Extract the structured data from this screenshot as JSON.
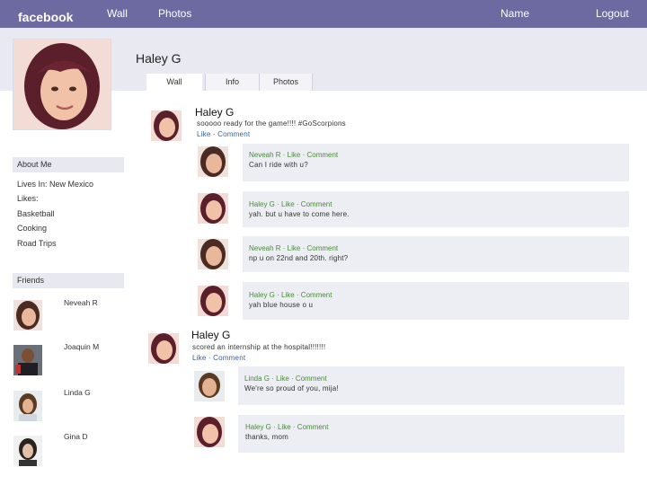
{
  "topbar": {
    "logo": "facebook",
    "nav_wall": "Wall",
    "nav_photos": "Photos",
    "nav_name": "Name",
    "nav_logout": "Logout"
  },
  "profile": {
    "name": "Haley G",
    "tabs": [
      "Wall",
      "Info",
      "Photos"
    ]
  },
  "about": {
    "heading": "About Me",
    "lives_in": "Lives In: New Mexico",
    "likes_label": "Likes:",
    "likes": [
      "Basketball",
      "Cooking",
      "Road Trips"
    ]
  },
  "friends": {
    "heading": "Friends",
    "list": [
      {
        "name": "Neveah R"
      },
      {
        "name": "Joaquin M"
      },
      {
        "name": "Linda G"
      },
      {
        "name": "Gina D"
      }
    ]
  },
  "posts": [
    {
      "author": "Haley G",
      "text": "sooooo ready for the game!!!! #GoScorpions",
      "actions": "Like · Comment",
      "comments": [
        {
          "meta": "Neveah R · Like · Comment",
          "text": "Can I ride with u?"
        },
        {
          "meta": "Haley G ·  Like · Comment",
          "text": "yah. but u have to come here."
        },
        {
          "meta": "Neveah R · Like · Comment",
          "text": "np u on 22nd and 20th. right?"
        },
        {
          "meta": "Haley G ·  Like · Comment",
          "text": "yah blue house o u"
        }
      ]
    },
    {
      "author": "Haley G",
      "text": "scored an internship at the hospital!!!!!!!",
      "actions": "Like · Comment",
      "comments": [
        {
          "meta": "Linda G · Like · Comment",
          "text": "We're so proud of you, mija!"
        },
        {
          "meta": "Haley G ·  Like · Comment",
          "text": "thanks, mom"
        }
      ]
    }
  ],
  "colors": {
    "topbar": "#6c6aa0",
    "header_band": "#e9eaf1",
    "link": "#3a5f9a",
    "meta_green": "#4a8a3a"
  }
}
